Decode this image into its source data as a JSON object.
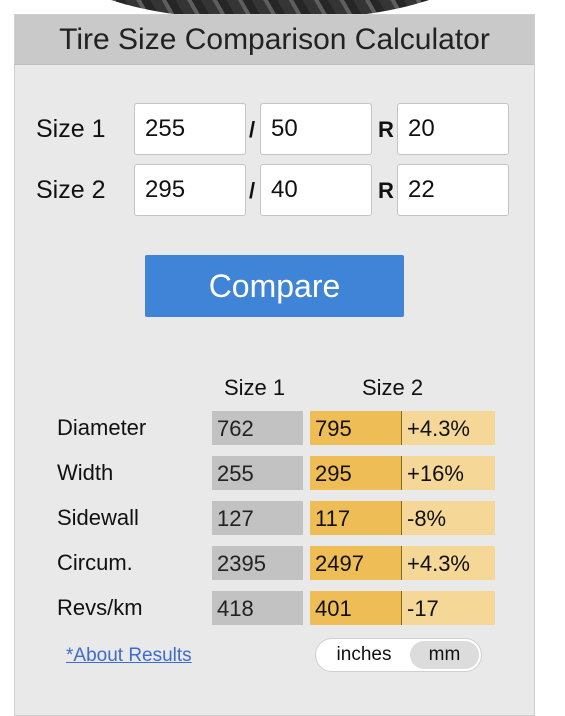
{
  "header": {
    "title": "Tire Size Comparison Calculator"
  },
  "sizes": [
    {
      "label": "Size 1",
      "width": "255",
      "aspect": "50",
      "rim": "20"
    },
    {
      "label": "Size 2",
      "width": "295",
      "aspect": "40",
      "rim": "22"
    }
  ],
  "separators": {
    "slash": "/",
    "rim": "R"
  },
  "compare_button": "Compare",
  "results": {
    "col1": "Size 1",
    "col2": "Size 2",
    "rows": [
      {
        "label": "Diameter",
        "v1": "762",
        "v2": "795",
        "diff": "+4.3%"
      },
      {
        "label": "Width",
        "v1": "255",
        "v2": "295",
        "diff": "+16%"
      },
      {
        "label": "Sidewall",
        "v1": "127",
        "v2": "117",
        "diff": "-8%"
      },
      {
        "label": "Circum.",
        "v1": "2395",
        "v2": "2497",
        "diff": "+4.3%"
      },
      {
        "label": "Revs/km",
        "v1": "418",
        "v2": "401",
        "diff": "-17"
      }
    ]
  },
  "about_link": "*About Results",
  "unit_toggle": {
    "options": [
      "inches",
      "mm"
    ],
    "selected": "mm"
  },
  "colors": {
    "compare_button": "#3f84d7",
    "size1_cell": "#c2c2c2",
    "size2_fill": "#efbd56",
    "size2_bar": "#f5d797",
    "link": "#3d6ccf"
  }
}
